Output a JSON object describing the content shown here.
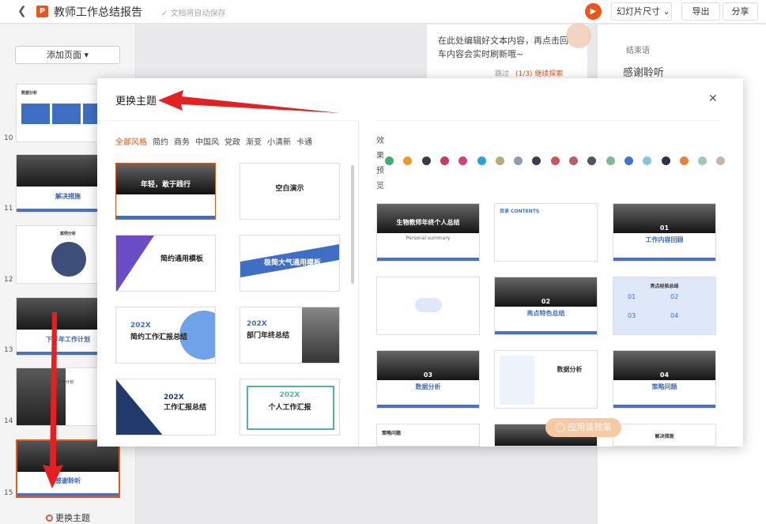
{
  "app": {
    "title": "教师工作总结报告",
    "save_status": "文档将自动保存",
    "slide_size_label": "幻灯片尺寸",
    "export_label": "导出",
    "share_label": "分享"
  },
  "sidebar": {
    "add_page_label": "添加页面",
    "slides": [
      {
        "num": "10",
        "title": "数据分析"
      },
      {
        "num": "11",
        "title": "解决措施"
      },
      {
        "num": "12",
        "title": "案例分析"
      },
      {
        "num": "13",
        "title": "下半年工作计划"
      },
      {
        "num": "14",
        "title": "工作计划"
      },
      {
        "num": "15",
        "title": "感谢聆听"
      }
    ],
    "footer_label": "更换主题"
  },
  "notes": {
    "text": "在此处编辑好文本内容，再点击回车内容会实时刷新哦~",
    "skip_label": "跳过",
    "next_label": "(1/3) 继续探索"
  },
  "right_panel": {
    "section_label": "结束语",
    "title": "感谢聆听"
  },
  "modal": {
    "title": "更换主题",
    "filters": [
      "全部风格",
      "简约",
      "商务",
      "中国风",
      "党政",
      "渐变",
      "小清新",
      "卡通"
    ],
    "templates": [
      {
        "title": "年轻，敢于践行"
      },
      {
        "title": "空白演示"
      },
      {
        "title": "简约通用模板"
      },
      {
        "title": "极简大气通用模板"
      },
      {
        "title": "简约工作汇报总结",
        "year": "202X"
      },
      {
        "title": "部门年终总结",
        "year": "202X"
      },
      {
        "title": "工作汇报总结",
        "year": "202X"
      },
      {
        "title": "个人工作汇报",
        "year": "202X"
      }
    ],
    "effect_label": "效果预览",
    "colors": [
      "#3fae6f",
      "#e89a2a",
      "#363b4d",
      "#c43a6a",
      "#d4417a",
      "#22a6d9",
      "#b0ae7a",
      "#8d9bb3",
      "#393d52",
      "#c7575a",
      "#b85c6b",
      "#4d5566",
      "#7dba95",
      "#3f73cf",
      "#88c4dc",
      "#2e3447",
      "#e87f35",
      "#a0c8b8",
      "#c8b7a2"
    ],
    "previews": [
      {
        "title": "生物教师年终个人总结",
        "subtitle": "Personal summary"
      },
      {
        "title": "目录 CONTENTS"
      },
      {
        "title": "工作内容回顾",
        "num": "01"
      },
      {
        "title": ""
      },
      {
        "title": "亮点特色总结",
        "num": "02"
      },
      {
        "title": "亮点经验总结",
        "nums": [
          "01",
          "02",
          "03",
          "04"
        ]
      },
      {
        "title": "数据分析",
        "num": "03"
      },
      {
        "title": "数据分析"
      },
      {
        "title": "策略问题",
        "num": "04"
      },
      {
        "title": "策略问题"
      },
      {
        "title": ""
      },
      {
        "title": "解决措施"
      }
    ],
    "apply_label": "应用该效果"
  }
}
